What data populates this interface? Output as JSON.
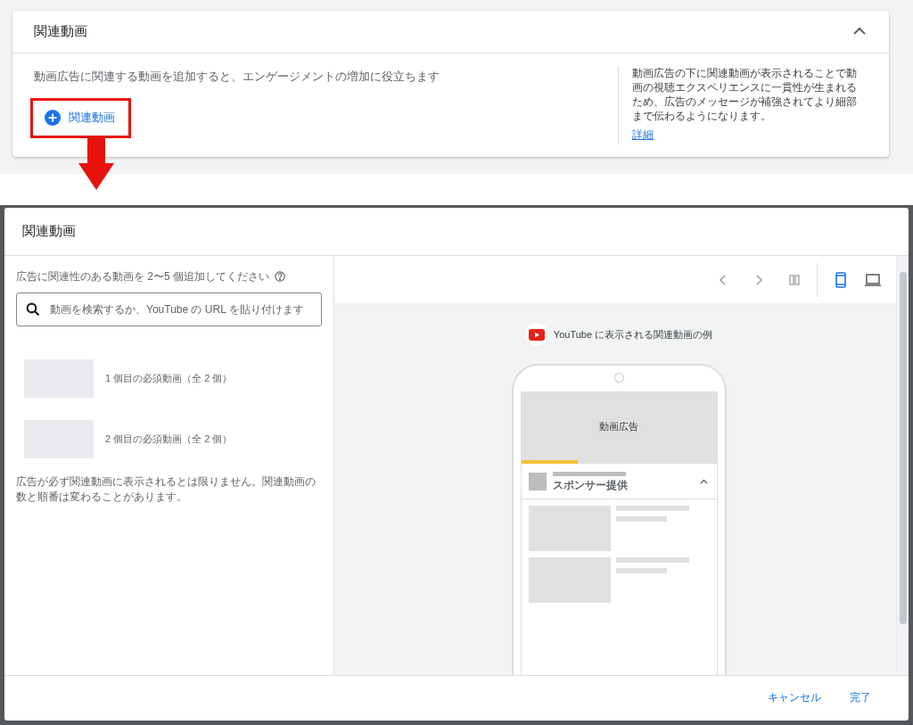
{
  "section": {
    "title": "関連動画",
    "expanded": true,
    "description": "動画広告に関連する動画を追加すると、エンゲージメントの増加に役立ちます",
    "add_button": "関連動画",
    "help_text": "動画広告の下に関連動画が表示されることで動画の視聴エクスペリエンスに一貫性が生まれるため、広告のメッセージが補強されてより細部まで伝わるようになります。",
    "help_link": "詳細"
  },
  "dialog": {
    "title": "関連動画",
    "instruction": "広告に関連性のある動画を 2〜5 個追加してください",
    "search": {
      "placeholder": "動画を検索するか、YouTube の URL を貼り付けます"
    },
    "slots": [
      {
        "label": "1 個目の必須動画（全 2 個）"
      },
      {
        "label": "2 個目の必須動画（全 2 個）"
      }
    ],
    "note": "広告が必ず関連動画に表示されるとは限りません。関連動画の数と順番は変わることがあります。",
    "devices": [
      {
        "kind": "mobile",
        "selected": true
      },
      {
        "kind": "desktop",
        "selected": false
      }
    ],
    "preview": {
      "caption": "YouTube に表示される関連動画の例",
      "ad_label": "動画広告",
      "level": 0.29,
      "sponsor_label": "スポンサー提供"
    },
    "buttons": [
      "キャンセル",
      "完了"
    ]
  }
}
